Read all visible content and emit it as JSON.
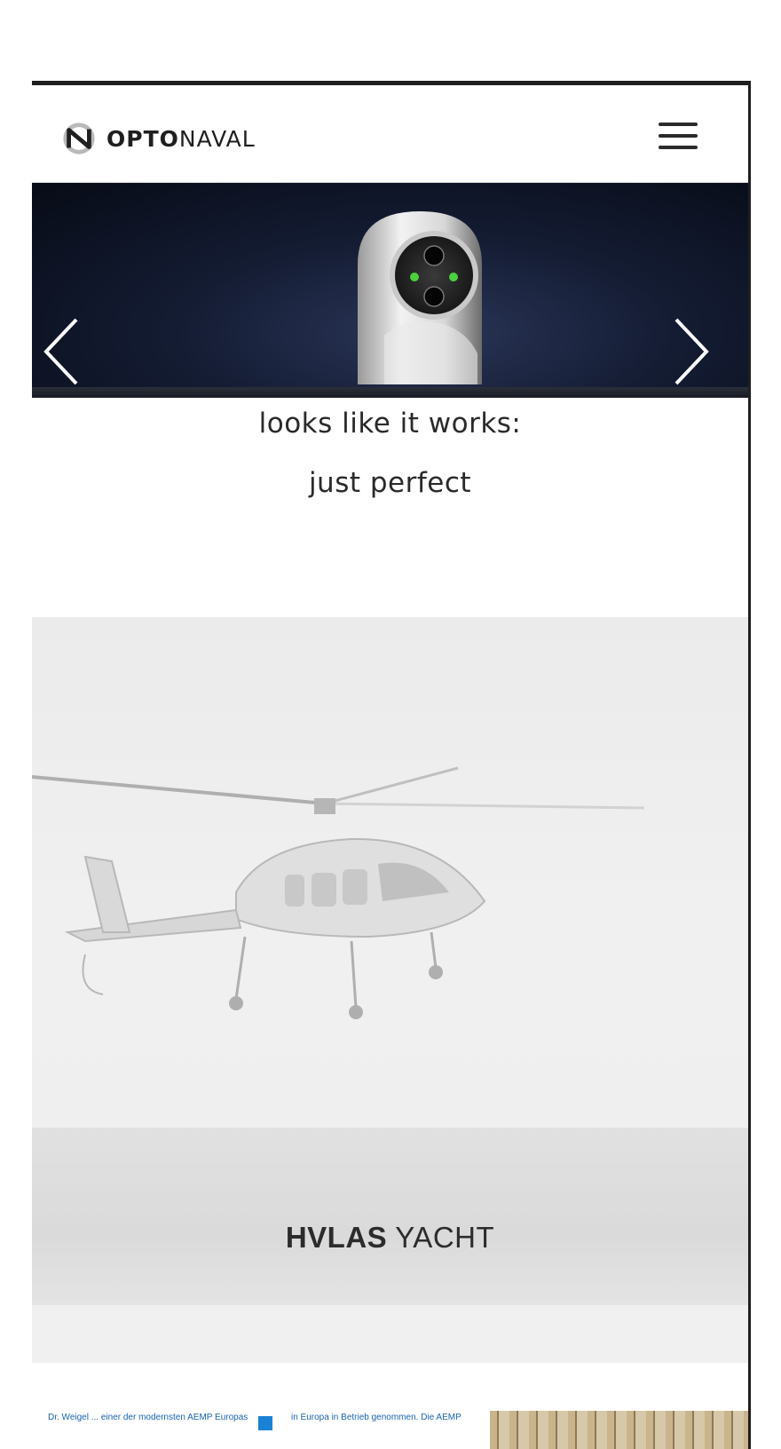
{
  "header": {
    "logo_bold": "OPTO",
    "logo_light": "NAVAL",
    "menu_icon": "hamburger-menu-icon"
  },
  "hero": {
    "prev_icon": "chevron-left-icon",
    "next_icon": "chevron-right-icon",
    "image": "thermal-camera-product-image"
  },
  "tagline": {
    "line1": "looks like it works:",
    "line2": "just perfect"
  },
  "feature": {
    "title_bold": "HVLAS",
    "title_light": "YACHT",
    "image": "helicopter-landing-image"
  },
  "news_strip": {
    "item1_text": "Dr. Weigel ... einer der modernsten AEMP Europas",
    "item2_text": "in Europa in Betrieb genommen. Die AEMP"
  },
  "colors": {
    "link_blue": "#1a63b0",
    "hero_bg": "#141c33",
    "text_dark": "#2a2a2a"
  }
}
